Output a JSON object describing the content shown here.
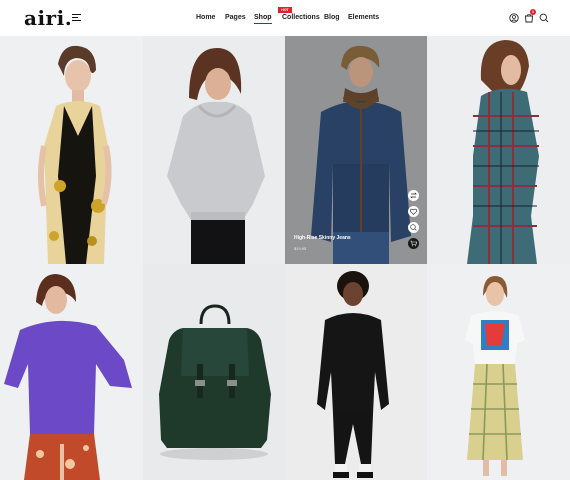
{
  "header": {
    "logo": "airi.",
    "nav": [
      {
        "label": "Home"
      },
      {
        "label": "Pages"
      },
      {
        "label": "Shop"
      },
      {
        "label": "Collections",
        "badge": "HOT"
      },
      {
        "label": "Blog"
      },
      {
        "label": "Elements"
      }
    ],
    "active_nav": "Shop",
    "cart_count": "0",
    "icons": [
      "menu-icon",
      "user-icon",
      "cart-icon",
      "search-icon"
    ]
  },
  "products": [
    {
      "tile": "woman-scarf-print-dress"
    },
    {
      "tile": "woman-grey-hoodie"
    },
    {
      "tile": "man-blue-shearling-jacket",
      "name": "High-Rise Skinny Jeans",
      "price": "$19.95",
      "hovered": true,
      "actions": [
        "compare-icon",
        "heart-icon",
        "quick-view-icon",
        "add-to-cart-icon"
      ]
    },
    {
      "tile": "woman-plaid-outfit"
    },
    {
      "tile": "woman-purple-sweater"
    },
    {
      "tile": "green-backpack"
    },
    {
      "tile": "man-black-suit"
    },
    {
      "tile": "woman-graphic-tee-plaid-skirt"
    }
  ],
  "colors": {
    "accent": "#e4202e",
    "hot": "#e4202e"
  }
}
